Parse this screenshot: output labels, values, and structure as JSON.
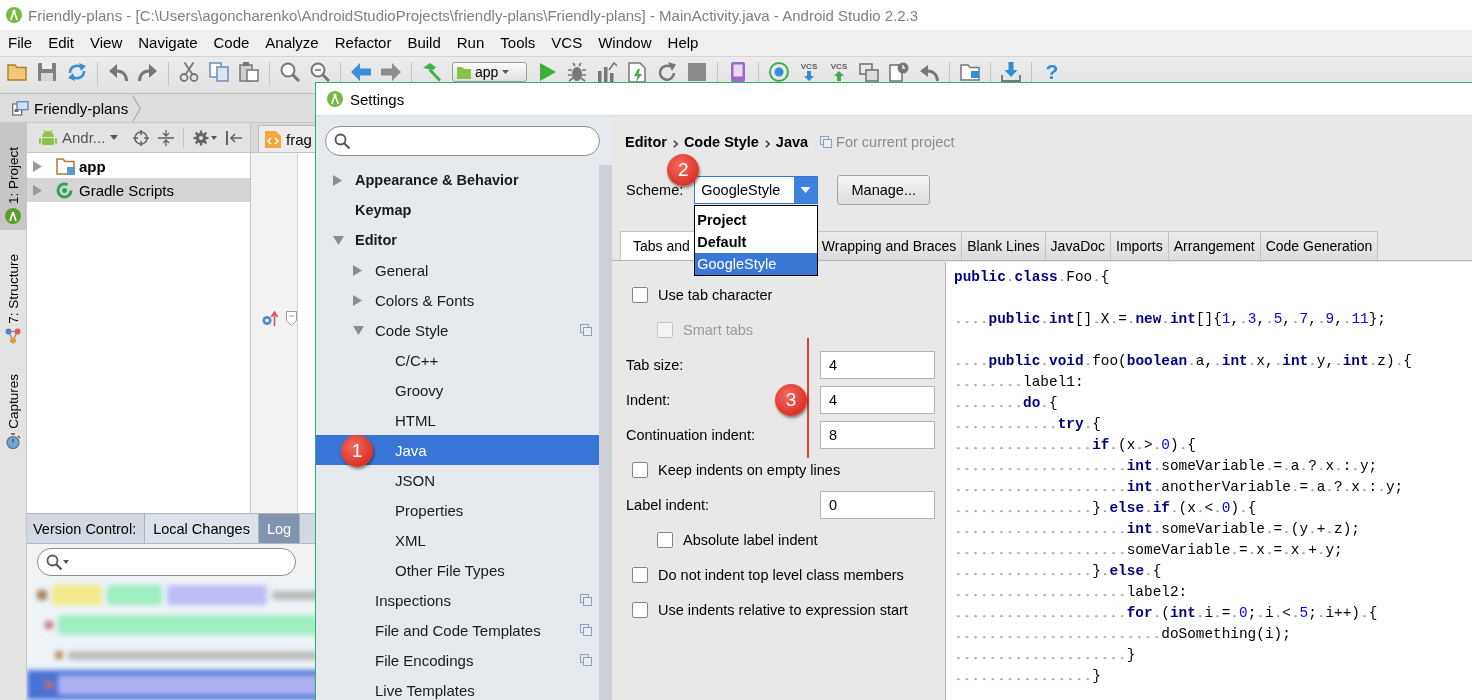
{
  "window": {
    "title": "Friendly-plans - [C:\\Users\\agoncharenko\\AndroidStudioProjects\\friendly-plans\\Friendly-plans] - MainActivity.java - Android Studio 2.2.3"
  },
  "menu": [
    "File",
    "Edit",
    "View",
    "Navigate",
    "Code",
    "Analyze",
    "Refactor",
    "Build",
    "Run",
    "Tools",
    "VCS",
    "Window",
    "Help"
  ],
  "toolbar": {
    "run_configuration": "app",
    "vcs_update": "VCS",
    "vcs_commit": "VCS",
    "help": "?"
  },
  "navigation_bar": {
    "crumbs": [
      "Friendly-plans"
    ]
  },
  "tool_window_tabs": [
    {
      "label": "1: Project",
      "selected": true
    },
    {
      "label": "7: Structure",
      "selected": false
    },
    {
      "label": "Captures",
      "selected": false
    }
  ],
  "project_panel": {
    "view": "Andr...",
    "tree": [
      {
        "kind": "module",
        "label": "app",
        "expanded": false,
        "selected": false
      },
      {
        "kind": "scripts",
        "label": "Gradle Scripts",
        "expanded": false,
        "selected": true
      }
    ]
  },
  "editor": {
    "tab": "frag"
  },
  "version_control": {
    "title": "Version Control:",
    "tabs": [
      {
        "label": "Local Changes",
        "selected": false
      },
      {
        "label": "Log",
        "selected": true
      }
    ]
  },
  "settings": {
    "title": "Settings",
    "tree": [
      {
        "kind": "group",
        "label": "Appearance & Behavior",
        "expanded": false,
        "selected": false,
        "per_project": false
      },
      {
        "kind": "page",
        "label": "Keymap",
        "selected": false,
        "per_project": false
      },
      {
        "kind": "group",
        "label": "Editor",
        "expanded": true,
        "selected": false,
        "per_project": false,
        "children": [
          {
            "kind": "group",
            "label": "General",
            "expanded": false,
            "selected": false,
            "per_project": false
          },
          {
            "kind": "group",
            "label": "Colors & Fonts",
            "expanded": false,
            "selected": false,
            "per_project": false
          },
          {
            "kind": "group",
            "label": "Code Style",
            "expanded": true,
            "selected": false,
            "per_project": true,
            "children": [
              {
                "kind": "page",
                "label": "C/C++",
                "selected": false,
                "per_project": false
              },
              {
                "kind": "page",
                "label": "Groovy",
                "selected": false,
                "per_project": false
              },
              {
                "kind": "page",
                "label": "HTML",
                "selected": false,
                "per_project": false
              },
              {
                "kind": "page",
                "label": "Java",
                "selected": true,
                "per_project": false,
                "callout": "1"
              },
              {
                "kind": "page",
                "label": "JSON",
                "selected": false,
                "per_project": false
              },
              {
                "kind": "page",
                "label": "Properties",
                "selected": false,
                "per_project": false
              },
              {
                "kind": "page",
                "label": "XML",
                "selected": false,
                "per_project": false
              },
              {
                "kind": "page",
                "label": "Other File Types",
                "selected": false,
                "per_project": false
              }
            ]
          },
          {
            "kind": "page",
            "label": "Inspections",
            "selected": false,
            "per_project": true
          },
          {
            "kind": "page",
            "label": "File and Code Templates",
            "selected": false,
            "per_project": true
          },
          {
            "kind": "page",
            "label": "File Encodings",
            "selected": false,
            "per_project": true
          },
          {
            "kind": "page",
            "label": "Live Templates",
            "selected": false,
            "per_project": false
          }
        ]
      }
    ],
    "breadcrumb": [
      "Editor",
      "Code Style",
      "Java"
    ],
    "scope": "For current project",
    "scheme": {
      "label": "Scheme:",
      "value": "GoogleStyle",
      "callout": "2",
      "expanded": true,
      "options": [
        {
          "label": "Project",
          "bold": true,
          "selected": false
        },
        {
          "label": "Default",
          "bold": true,
          "selected": false
        },
        {
          "label": "GoogleStyle",
          "bold": false,
          "selected": true
        }
      ]
    },
    "manage_button": "Manage...",
    "tabs": [
      {
        "label": "Tabs and",
        "selected": true
      },
      {
        "label": "Wrapping and Braces",
        "selected": false
      },
      {
        "label": "Blank Lines",
        "selected": false
      },
      {
        "label": "JavaDoc",
        "selected": false
      },
      {
        "label": "Imports",
        "selected": false
      },
      {
        "label": "Arrangement",
        "selected": false
      },
      {
        "label": "Code Generation",
        "selected": false
      }
    ],
    "options": [
      {
        "kind": "checkbox",
        "label": "Use tab character",
        "checked": false,
        "disabled": false,
        "children": [
          {
            "kind": "checkbox",
            "label": "Smart tabs",
            "checked": false,
            "disabled": true
          }
        ]
      },
      {
        "kind": "number",
        "label": "Tab size:",
        "value": "4"
      },
      {
        "kind": "number",
        "label": "Indent:",
        "value": "4",
        "callout": "3"
      },
      {
        "kind": "number",
        "label": "Continuation indent:",
        "value": "8"
      },
      {
        "kind": "checkbox",
        "label": "Keep indents on empty lines",
        "checked": false,
        "disabled": false
      },
      {
        "kind": "number",
        "label": "Label indent:",
        "value": "0",
        "children": [
          {
            "kind": "checkbox",
            "label": "Absolute label indent",
            "checked": false,
            "disabled": false
          }
        ]
      },
      {
        "kind": "checkbox",
        "label": "Do not indent top level class members",
        "checked": false,
        "disabled": false
      },
      {
        "kind": "checkbox",
        "label": "Use indents relative to expression start",
        "checked": false,
        "disabled": false
      }
    ],
    "preview": {
      "lines": [
        {
          "kind": "code",
          "segments": [
            {
              "kind": "keyword",
              "text": "public class"
            },
            {
              "kind": "plain",
              "text": " Foo {"
            }
          ]
        },
        {
          "kind": "blank"
        },
        {
          "kind": "code",
          "segments": [
            {
              "kind": "keyword",
              "text": "    public int"
            },
            {
              "kind": "plain",
              "text": "[] X = "
            },
            {
              "kind": "keyword",
              "text": "new int"
            },
            {
              "kind": "plain",
              "text": "[]{"
            },
            {
              "kind": "number",
              "text": "1"
            },
            {
              "kind": "plain",
              "text": ", "
            },
            {
              "kind": "number",
              "text": "3"
            },
            {
              "kind": "plain",
              "text": ", "
            },
            {
              "kind": "number",
              "text": "5"
            },
            {
              "kind": "plain",
              "text": ", "
            },
            {
              "kind": "number",
              "text": "7"
            },
            {
              "kind": "plain",
              "text": ", "
            },
            {
              "kind": "number",
              "text": "9"
            },
            {
              "kind": "plain",
              "text": ", "
            },
            {
              "kind": "number",
              "text": "11"
            },
            {
              "kind": "plain",
              "text": "};"
            }
          ]
        },
        {
          "kind": "blank"
        },
        {
          "kind": "code",
          "segments": [
            {
              "kind": "keyword",
              "text": "    public void"
            },
            {
              "kind": "plain",
              "text": " foo("
            },
            {
              "kind": "keyword",
              "text": "boolean"
            },
            {
              "kind": "plain",
              "text": " a, "
            },
            {
              "kind": "keyword",
              "text": "int"
            },
            {
              "kind": "plain",
              "text": " x, "
            },
            {
              "kind": "keyword",
              "text": "int"
            },
            {
              "kind": "plain",
              "text": " y, "
            },
            {
              "kind": "keyword",
              "text": "int"
            },
            {
              "kind": "plain",
              "text": " z) {"
            }
          ]
        },
        {
          "kind": "code",
          "segments": [
            {
              "kind": "plain",
              "text": "        label1:"
            }
          ]
        },
        {
          "kind": "code",
          "segments": [
            {
              "kind": "keyword",
              "text": "        do"
            },
            {
              "kind": "plain",
              "text": " {"
            }
          ]
        },
        {
          "kind": "code",
          "segments": [
            {
              "kind": "keyword",
              "text": "            try"
            },
            {
              "kind": "plain",
              "text": " {"
            }
          ]
        },
        {
          "kind": "code",
          "segments": [
            {
              "kind": "keyword",
              "text": "                if"
            },
            {
              "kind": "plain",
              "text": " (x > "
            },
            {
              "kind": "number",
              "text": "0"
            },
            {
              "kind": "plain",
              "text": ") {"
            }
          ]
        },
        {
          "kind": "code",
          "segments": [
            {
              "kind": "keyword",
              "text": "                    int"
            },
            {
              "kind": "plain",
              "text": " someVariable = a ? x : y;"
            }
          ]
        },
        {
          "kind": "code",
          "segments": [
            {
              "kind": "keyword",
              "text": "                    int"
            },
            {
              "kind": "plain",
              "text": " anotherVariable = a ? x : y;"
            }
          ]
        },
        {
          "kind": "code",
          "segments": [
            {
              "kind": "plain",
              "text": "                } "
            },
            {
              "kind": "keyword",
              "text": "else if"
            },
            {
              "kind": "plain",
              "text": " (x < "
            },
            {
              "kind": "number",
              "text": "0"
            },
            {
              "kind": "plain",
              "text": ") {"
            }
          ]
        },
        {
          "kind": "code",
          "segments": [
            {
              "kind": "keyword",
              "text": "                    int"
            },
            {
              "kind": "plain",
              "text": " someVariable = (y + z);"
            }
          ]
        },
        {
          "kind": "code",
          "segments": [
            {
              "kind": "plain",
              "text": "                    someVariable = x = x + y;"
            }
          ]
        },
        {
          "kind": "code",
          "segments": [
            {
              "kind": "plain",
              "text": "                } "
            },
            {
              "kind": "keyword",
              "text": "else"
            },
            {
              "kind": "plain",
              "text": " {"
            }
          ]
        },
        {
          "kind": "code",
          "segments": [
            {
              "kind": "plain",
              "text": "                    label2:"
            }
          ]
        },
        {
          "kind": "code",
          "segments": [
            {
              "kind": "keyword",
              "text": "                    for"
            },
            {
              "kind": "plain",
              "text": " ("
            },
            {
              "kind": "keyword",
              "text": "int"
            },
            {
              "kind": "plain",
              "text": " i = "
            },
            {
              "kind": "number",
              "text": "0"
            },
            {
              "kind": "plain",
              "text": "; i < "
            },
            {
              "kind": "number",
              "text": "5"
            },
            {
              "kind": "plain",
              "text": "; i++) {"
            }
          ]
        },
        {
          "kind": "code",
          "segments": [
            {
              "kind": "plain",
              "text": "                        doSomething(i);"
            }
          ]
        },
        {
          "kind": "code",
          "segments": [
            {
              "kind": "plain",
              "text": "                    }"
            }
          ]
        },
        {
          "kind": "code",
          "segments": [
            {
              "kind": "plain",
              "text": "                }"
            }
          ]
        }
      ]
    }
  }
}
